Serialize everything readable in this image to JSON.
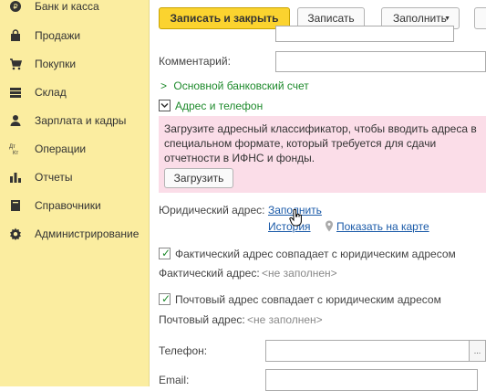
{
  "sidebar": {
    "items": [
      {
        "label": "Банк и касса",
        "icon": "bank-icon"
      },
      {
        "label": "Продажи",
        "icon": "bag-icon"
      },
      {
        "label": "Покупки",
        "icon": "cart-icon"
      },
      {
        "label": "Склад",
        "icon": "warehouse-icon"
      },
      {
        "label": "Зарплата и кадры",
        "icon": "person-icon"
      },
      {
        "label": "Операции",
        "icon": "operations-icon"
      },
      {
        "label": "Отчеты",
        "icon": "chart-icon"
      },
      {
        "label": "Справочники",
        "icon": "book-icon"
      },
      {
        "label": "Администрирование",
        "icon": "gear-icon"
      }
    ]
  },
  "toolbar": {
    "save_close_label": "Записать и закрыть",
    "save_label": "Записать",
    "fill_label": "Заполнить"
  },
  "form": {
    "comment_label": "Комментарий:",
    "bank_account_label": "Основной банковский счет",
    "address_phone_label": "Адрес и телефон",
    "notice_text": "Загрузите адресный классификатор, чтобы вводить адреса в специальном формате, который требуется для сдачи отчетности в ИФНС и фонды.",
    "load_label": "Загрузить",
    "legal_address_label": "Юридический адрес:",
    "legal_address_fill": "Заполнить",
    "history_label": "История",
    "show_on_map_label": "Показать на карте",
    "actual_same_label": "Фактический адрес совпадает с юридическим адресом",
    "actual_address_label": "Фактический адрес:",
    "actual_address_value": "<не заполнен>",
    "postal_same_label": "Почтовый адрес совпадает с юридическим адресом",
    "postal_address_label": "Почтовый адрес:",
    "postal_address_value": "<не заполнен>",
    "phone_label": "Телефон:",
    "phone_button": "...",
    "email_label": "Email:"
  },
  "colors": {
    "sidebar_bg": "#fbeda0",
    "primary_button": "#fbd32f",
    "notice_bg": "#fbdde8",
    "link": "#1a5aa8",
    "accent_green": "#1e8a2c"
  }
}
